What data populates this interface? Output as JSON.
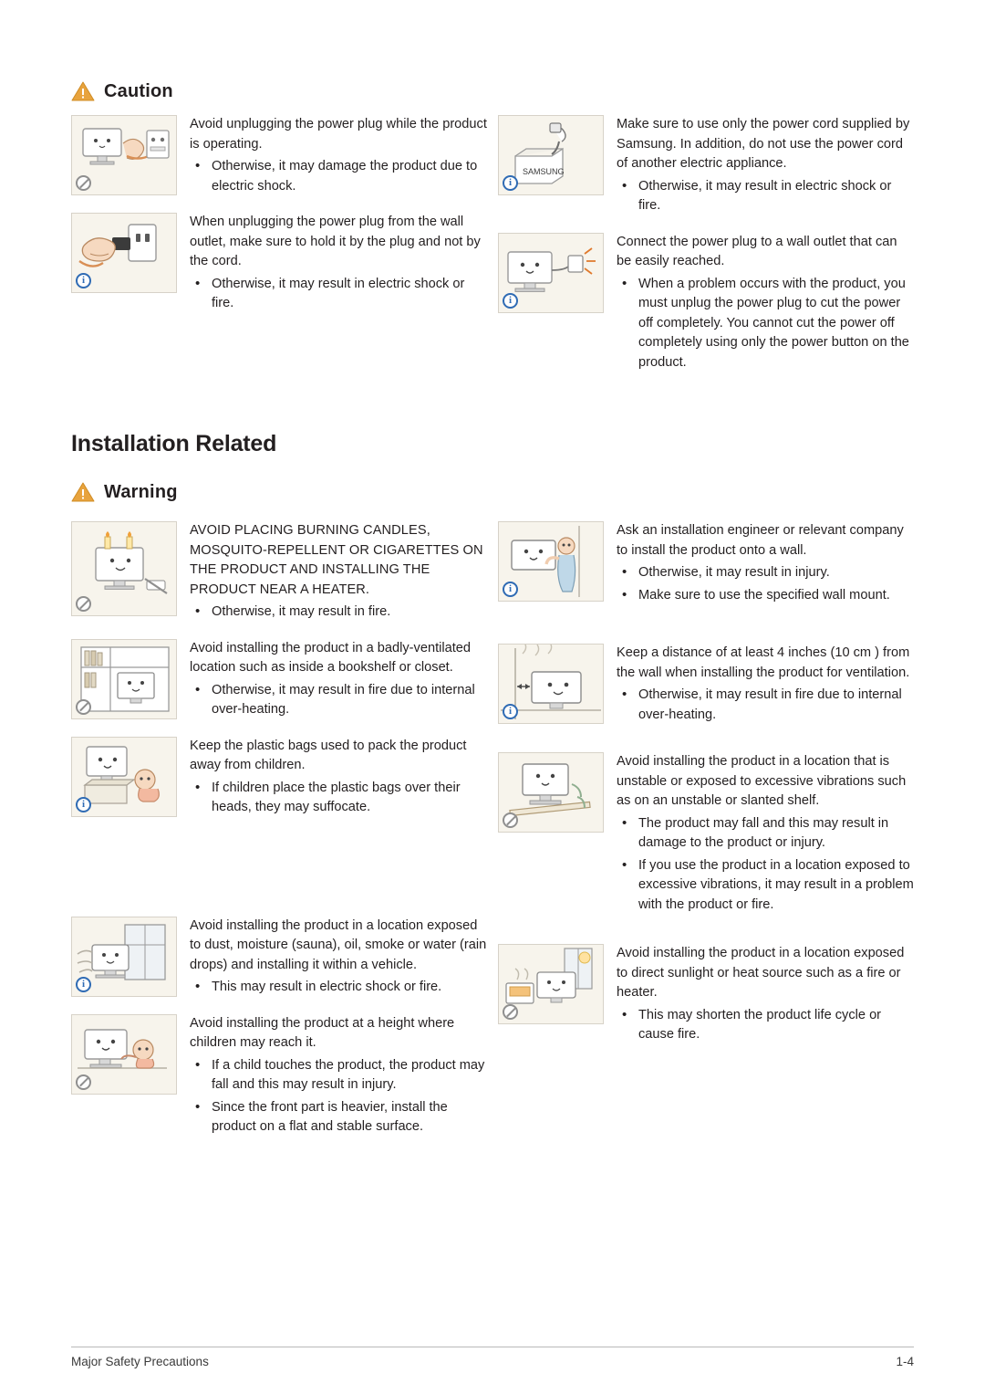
{
  "headings": {
    "caution": "Caution",
    "chapter": "Installation Related",
    "warning": "Warning"
  },
  "caution_items": [
    {
      "icon": "monitor-unplug-icon",
      "badge": "prohibit",
      "text": "Avoid unplugging the power plug while the product is operating.",
      "bullets": [
        "Otherwise, it may damage the product due to electric shock."
      ]
    },
    {
      "icon": "power-cord-box-icon",
      "badge": "info",
      "text": "Make sure to use only the power cord supplied by Samsung. In addition, do not use the power cord of another electric appliance.",
      "bullets": [
        "Otherwise, it may result in electric shock or fire."
      ]
    },
    {
      "icon": "hand-pull-plug-icon",
      "badge": "info",
      "text": "When unplugging the power plug from the wall outlet, make sure to hold it by the plug and not by the cord.",
      "bullets": [
        "Otherwise, it may result in electric shock or fire."
      ]
    },
    {
      "icon": "monitor-wall-outlet-icon",
      "badge": "info",
      "text": "Connect the power plug to a wall outlet that can be easily reached.",
      "bullets": [
        "When a problem occurs with the product, you must unplug the power plug to cut the power off completely. You cannot cut the power off completely using only the power button on the product."
      ]
    }
  ],
  "warning_items": [
    {
      "icon": "candle-cigarette-heater-icon",
      "badge": "prohibit",
      "text": "AVOID PLACING BURNING CANDLES, MOSQUITO-REPELLENT OR CIGARETTES ON THE PRODUCT AND INSTALLING THE PRODUCT NEAR A HEATER.",
      "bullets": [
        "Otherwise, it may result in fire."
      ]
    },
    {
      "icon": "wall-mount-install-icon",
      "badge": "info",
      "text": "Ask an installation engineer or relevant company to install the product onto a wall.",
      "bullets": [
        "Otherwise, it may result in injury.",
        "Make sure to use the specified wall mount."
      ]
    },
    {
      "icon": "bookshelf-ventilation-icon",
      "badge": "prohibit",
      "text": "Avoid installing the product in a badly-ventilated location such as inside a bookshelf or closet.",
      "bullets": [
        "Otherwise, it may result in fire due to internal over-heating."
      ]
    },
    {
      "icon": "wall-distance-icon",
      "badge": "info",
      "text": "Keep a distance of at least 4 inches (10 cm ) from the wall when installing the product for ventilation.",
      "bullets": [
        "Otherwise, it may result in fire due to internal over-heating."
      ]
    },
    {
      "icon": "plastic-bag-child-icon",
      "badge": "info",
      "text": "Keep the plastic bags used to pack the product away from children.",
      "bullets": [
        "If children place the plastic bags over their heads, they may suffocate."
      ]
    },
    {
      "icon": "unstable-shelf-icon",
      "badge": "prohibit",
      "text": "Avoid installing the product in a location that is unstable or exposed to excessive vibrations such as on an unstable or slanted shelf.",
      "bullets": [
        "The product may fall and this may result in damage to the product or injury.",
        "If you use the product in a location exposed to excessive vibrations, it may result in a problem with the product or fire."
      ]
    },
    {
      "icon": "dust-moisture-vehicle-icon",
      "badge": "info",
      "text": "Avoid installing the product in a location exposed to dust, moisture (sauna), oil, smoke or water (rain drops) and installing it within a vehicle.",
      "bullets": [
        "This may result in electric shock or fire."
      ]
    },
    {
      "icon": "sunlight-heat-source-icon",
      "badge": "prohibit",
      "text": "Avoid installing the product in a location exposed to direct sunlight or heat source such as a fire or heater.",
      "bullets": [
        "This may shorten the product life cycle or cause fire."
      ]
    },
    {
      "icon": "child-reach-height-icon",
      "badge": "prohibit",
      "text": "Avoid installing the product at a height where children may reach it.",
      "bullets": [
        "If a child touches the product, the product may fall and this may result in injury.",
        "Since the front part is heavier, install the product on a flat and stable surface."
      ]
    }
  ],
  "footer": {
    "left": "Major Safety Precautions",
    "right": "1-4"
  },
  "colors": {
    "warning_triangle": "#e8a33d",
    "prohibit": "#8f8f8f",
    "info": "#2f6bb4",
    "panel_bg": "#f7f4ec",
    "panel_border": "#d7d2c8"
  }
}
